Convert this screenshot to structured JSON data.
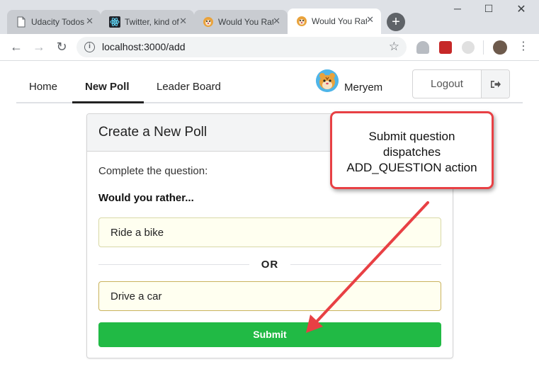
{
  "browser": {
    "tabs": [
      {
        "title": "Udacity Todos",
        "active": false,
        "icon": "document-icon"
      },
      {
        "title": "Twitter, kind of",
        "active": false,
        "icon": "react-icon"
      },
      {
        "title": "Would You Rather",
        "active": false,
        "icon": "tiger-icon"
      },
      {
        "title": "Would You Rather",
        "active": true,
        "icon": "tiger-icon"
      }
    ],
    "new_tab_symbol": "+",
    "url": "localhost:3000/add",
    "window_controls": [
      "minimize",
      "maximize",
      "close"
    ]
  },
  "app": {
    "nav": {
      "items": [
        {
          "label": "Home",
          "active": false
        },
        {
          "label": "New Poll",
          "active": true
        },
        {
          "label": "Leader Board",
          "active": false
        }
      ],
      "user": {
        "name": "Meryem",
        "avatar": "tiger-avatar"
      },
      "logout_label": "Logout"
    },
    "card": {
      "title": "Create a New Poll",
      "prompt": "Complete the question:",
      "heading": "Would you rather...",
      "option_one_value": "Ride a bike",
      "option_two_value": "Drive a car",
      "or_label": "OR",
      "submit_label": "Submit"
    }
  },
  "annotation": {
    "lines": [
      "Submit question",
      "dispatches",
      "ADD_QUESTION action"
    ],
    "color": "#e84044"
  },
  "colors": {
    "submit": "#21ba45",
    "input_bg": "#fffff0",
    "annotation": "#e84044"
  }
}
